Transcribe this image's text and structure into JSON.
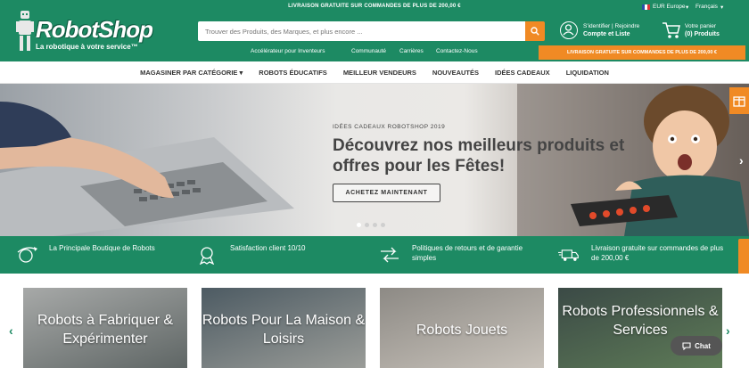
{
  "header": {
    "promo_top": "LIVRAISON GRATUITE SUR COMMANDES DE PLUS DE 200,00 €",
    "currency": "EUR Europe",
    "language": "Français",
    "logo_text": "RobotShop",
    "tagline": "La robotique à votre service™",
    "search_placeholder": "Trouver des Produits, des Marques, et plus encore ...",
    "links": [
      "Accélérateur pour Inventeurs",
      "Communauté",
      "Carrières",
      "Contactez-Nous"
    ],
    "account_line1": "S'identifier | Rejoindre",
    "account_line2": "Compte et Liste",
    "cart_line1": "Votre panier",
    "cart_line2": "(0) Produits",
    "cart_promo": "LIVRAISON GRATUITE SUR COMMANDES DE PLUS DE 200,00 €"
  },
  "nav": {
    "items": [
      "MAGASINER PAR CATÉGORIE",
      "ROBOTS ÉDUCATIFS",
      "MEILLEUR VENDEURS",
      "NOUVEAUTÉS",
      "IDÉES CADEAUX",
      "LIQUIDATION"
    ]
  },
  "hero": {
    "eyebrow": "IDÉES CADEAUX ROBOTSHOP 2019",
    "title": "Découvrez nos meilleurs produits et offres pour les Fêtes!",
    "cta": "ACHETEZ MAINTENANT",
    "active_slide": 1,
    "slide_count": 4
  },
  "features": [
    {
      "icon": "globe-plane-icon",
      "text": "La Principale Boutique de Robots"
    },
    {
      "icon": "award-badge-icon",
      "text": "Satisfaction client 10/10"
    },
    {
      "icon": "return-arrows-icon",
      "text": "Politiques de retours et de garantie simples"
    },
    {
      "icon": "delivery-truck-icon",
      "text": "Livraison gratuite sur commandes de plus de 200,00 €"
    }
  ],
  "categories": [
    {
      "label": "Robots à Fabriquer & Expérimenter"
    },
    {
      "label": "Robots Pour La Maison & Loisirs"
    },
    {
      "label": "Robots Jouets"
    },
    {
      "label": "Robots Professionnels & Services"
    }
  ],
  "chat": {
    "label": "Chat"
  },
  "side_tab": {
    "label": "Votre avis"
  },
  "colors": {
    "brand_green": "#1d8a63",
    "accent_orange": "#f08a24"
  }
}
